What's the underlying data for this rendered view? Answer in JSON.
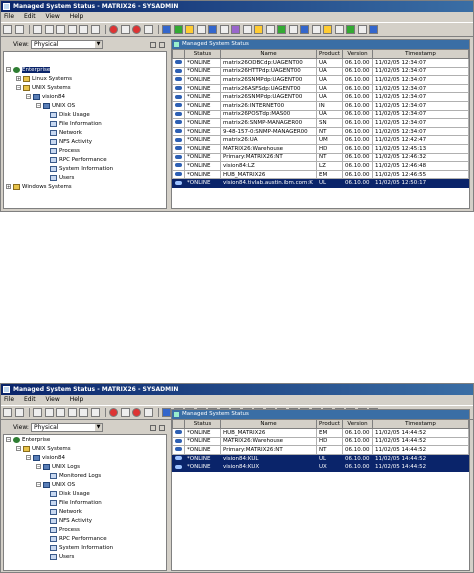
{
  "screen1": {
    "title": "Managed System Status - MATRIX26 - SYSADMIN",
    "menu": [
      "File",
      "Edit",
      "View",
      "Help"
    ],
    "view_label": "View:",
    "view_value": "Physical",
    "panel_title": "Managed System Status",
    "columns": [
      "Status",
      "Name",
      "Product",
      "Version",
      "Timestamp"
    ],
    "tree": {
      "enterprise": "Enterprise",
      "linux": "Linux Systems",
      "unix": "UNIX Systems",
      "host": "vision84",
      "os": "UNIX OS",
      "children": [
        "Disk Usage",
        "File Information",
        "Network",
        "NFS Activity",
        "Process",
        "RPC Performance",
        "System Information",
        "Users"
      ],
      "windows": "Windows Systems"
    },
    "rows": [
      {
        "status": "*ONLINE",
        "name": "matrix26ODBCdp:UAGENT00",
        "product": "UA",
        "version": "06.10.00",
        "timestamp": "11/02/05 12:34:07"
      },
      {
        "status": "*ONLINE",
        "name": "matrix26HTTPdp:UAGENT00",
        "product": "UA",
        "version": "06.10.00",
        "timestamp": "11/02/05 12:34:07"
      },
      {
        "status": "*ONLINE",
        "name": "matrix26SNMPdp:UAGENT00",
        "product": "UA",
        "version": "06.10.00",
        "timestamp": "11/02/05 12:34:07"
      },
      {
        "status": "*ONLINE",
        "name": "matrix26ASFSdp:UAGENT00",
        "product": "UA",
        "version": "06.10.00",
        "timestamp": "11/02/05 12:34:07"
      },
      {
        "status": "*ONLINE",
        "name": "matrix26SNMPdp:UAGENT00",
        "product": "UA",
        "version": "06.10.00",
        "timestamp": "11/02/05 12:34:07"
      },
      {
        "status": "*ONLINE",
        "name": "matrix26:INTERNET00",
        "product": "IN",
        "version": "06.10.00",
        "timestamp": "11/02/05 12:34:07"
      },
      {
        "status": "*ONLINE",
        "name": "matrix26POSTdp:MAS00",
        "product": "UA",
        "version": "06.10.00",
        "timestamp": "11/02/05 12:34:07"
      },
      {
        "status": "*ONLINE",
        "name": "matrix26:SNMP-MANAGER00",
        "product": "SN",
        "version": "06.10.00",
        "timestamp": "11/02/05 12:34:07"
      },
      {
        "status": "*ONLINE",
        "name": "9-48-157-0:SNMP-MANAGER00",
        "product": "NT",
        "version": "06.10.00",
        "timestamp": "11/02/05 12:34:07"
      },
      {
        "status": "*ONLINE",
        "name": "matrix26:UA",
        "product": "UM",
        "version": "06.10.00",
        "timestamp": "11/02/05 12:42:47"
      },
      {
        "status": "*ONLINE",
        "name": "MATRIX26:Warehouse",
        "product": "HD",
        "version": "06.10.00",
        "timestamp": "11/02/05 12:45:13"
      },
      {
        "status": "*ONLINE",
        "name": "Primary:MATRIX26:NT",
        "product": "NT",
        "version": "06.10.00",
        "timestamp": "11/02/05 12:46:32"
      },
      {
        "status": "*ONLINE",
        "name": "vision84:LZ",
        "product": "LZ",
        "version": "06.10.00",
        "timestamp": "11/02/05 12:46:48"
      },
      {
        "status": "*ONLINE",
        "name": "HUB_MATRIX26",
        "product": "EM",
        "version": "06.10.00",
        "timestamp": "11/02/05 12:46:55"
      },
      {
        "status": "*ONLINE",
        "name": "vision84.tivlab.austin.ibm.com:K",
        "product": "UL",
        "version": "06.10.00",
        "timestamp": "11/02/05 12:50:17"
      }
    ]
  },
  "screen2": {
    "title": "Managed System Status - MATRIX26 - SYSADMIN",
    "menu": [
      "File",
      "Edit",
      "View",
      "Help"
    ],
    "view_label": "View:",
    "view_value": "Physical",
    "panel_title": "Managed System Status",
    "columns": [
      "Status",
      "Name",
      "Product",
      "Version",
      "Timestamp"
    ],
    "tree": {
      "enterprise": "Enterprise",
      "unix": "UNIX Systems",
      "host": "vision84",
      "logs": "UNIX Logs",
      "monitored": "Monitored Logs",
      "os": "UNIX OS",
      "children": [
        "Disk Usage",
        "File Information",
        "Network",
        "NFS Activity",
        "Process",
        "RPC Performance",
        "System Information",
        "Users"
      ]
    },
    "rows": [
      {
        "status": "*ONLINE",
        "name": "HUB_MATRIX26",
        "product": "EM",
        "version": "06.10.00",
        "timestamp": "11/02/05 14:44:52"
      },
      {
        "status": "*ONLINE",
        "name": "MATRIX26:Warehouse",
        "product": "HD",
        "version": "06.10.00",
        "timestamp": "11/02/05 14:44:52"
      },
      {
        "status": "*ONLINE",
        "name": "Primary:MATRIX26:NT",
        "product": "NT",
        "version": "06.10.00",
        "timestamp": "11/02/05 14:44:52"
      },
      {
        "status": "*ONLINE",
        "name": "vision84:KUL",
        "product": "UL",
        "version": "06.10.00",
        "timestamp": "11/02/05 14:44:52"
      },
      {
        "status": "*ONLINE",
        "name": "vision84:KUX",
        "product": "UX",
        "version": "06.10.00",
        "timestamp": "11/02/05 14:44:52"
      }
    ]
  }
}
